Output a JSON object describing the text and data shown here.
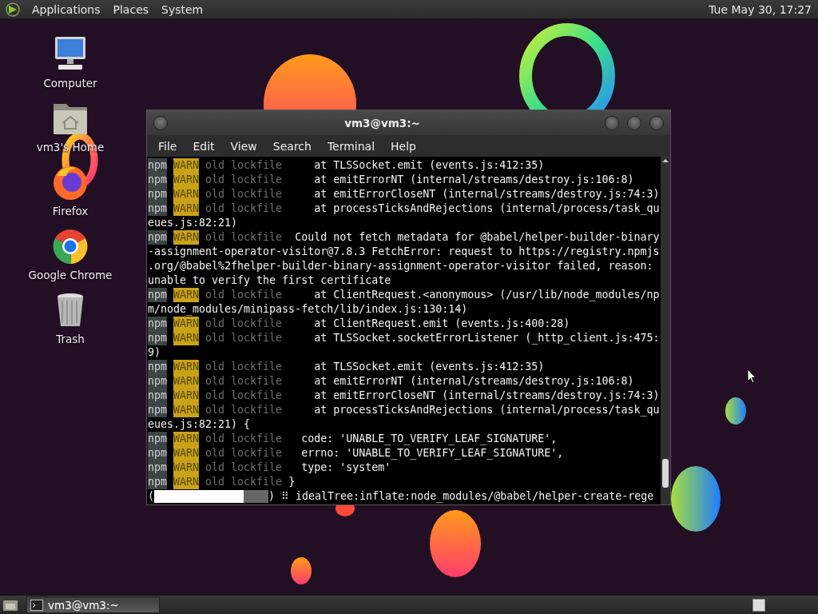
{
  "top_panel": {
    "menus": [
      "Applications",
      "Places",
      "System"
    ],
    "clock": "Tue May 30, 17:27"
  },
  "desktop_icons": [
    {
      "label": "Computer",
      "kind": "computer"
    },
    {
      "label": "vm3's Home",
      "kind": "home"
    },
    {
      "label": "Firefox",
      "kind": "firefox"
    },
    {
      "label": "Google Chrome",
      "kind": "chrome"
    },
    {
      "label": "Trash",
      "kind": "trash"
    }
  ],
  "terminal": {
    "title": "vm3@vm3:~",
    "menu": [
      "File",
      "Edit",
      "View",
      "Search",
      "Terminal",
      "Help"
    ],
    "lines": [
      {
        "kind": "stack",
        "npm": "npm",
        "level_tag": "WARN",
        "tag": "old lockfile",
        "text": "at TLSSocket.emit (events.js:412:35)"
      },
      {
        "kind": "stack",
        "npm": "npm",
        "level_tag": "WARN",
        "tag": "old lockfile",
        "text": "at emitErrorNT (internal/streams/destroy.js:106:8)"
      },
      {
        "kind": "stack",
        "npm": "npm",
        "level_tag": "WARN",
        "tag": "old lockfile",
        "text": "at emitErrorCloseNT (internal/streams/destroy.js:74:3)"
      },
      {
        "kind": "stack",
        "npm": "npm",
        "level_tag": "WARN",
        "tag": "old lockfile",
        "text": "at processTicksAndRejections (internal/process/task_qu"
      },
      {
        "kind": "plain",
        "text": "eues.js:82:21)"
      },
      {
        "kind": "info",
        "npm": "npm",
        "level_tag": "WARN",
        "tag": "old lockfile",
        "text": "Could not fetch metadata for @babel/helper-builder-binary"
      },
      {
        "kind": "plain",
        "text": "-assignment-operator-visitor@7.8.3 FetchError: request to https://registry.npmjs"
      },
      {
        "kind": "plain",
        "text": ".org/@babel%2fhelper-builder-binary-assignment-operator-visitor failed, reason:"
      },
      {
        "kind": "plain",
        "text": "unable to verify the first certificate"
      },
      {
        "kind": "stack",
        "npm": "npm",
        "level_tag": "WARN",
        "tag": "old lockfile",
        "text": "at ClientRequest.<anonymous> (/usr/lib/node_modules/np"
      },
      {
        "kind": "plain",
        "text": "m/node_modules/minipass-fetch/lib/index.js:130:14)"
      },
      {
        "kind": "stack",
        "npm": "npm",
        "level_tag": "WARN",
        "tag": "old lockfile",
        "text": "at ClientRequest.emit (events.js:400:28)"
      },
      {
        "kind": "stack",
        "npm": "npm",
        "level_tag": "WARN",
        "tag": "old lockfile",
        "text": "at TLSSocket.socketErrorListener (_http_client.js:475:"
      },
      {
        "kind": "plain",
        "text": "9)"
      },
      {
        "kind": "stack",
        "npm": "npm",
        "level_tag": "WARN",
        "tag": "old lockfile",
        "text": "at TLSSocket.emit (events.js:412:35)"
      },
      {
        "kind": "stack",
        "npm": "npm",
        "level_tag": "WARN",
        "tag": "old lockfile",
        "text": "at emitErrorNT (internal/streams/destroy.js:106:8)"
      },
      {
        "kind": "stack",
        "npm": "npm",
        "level_tag": "WARN",
        "tag": "old lockfile",
        "text": "at emitErrorCloseNT (internal/streams/destroy.js:74:3)"
      },
      {
        "kind": "stack",
        "npm": "npm",
        "level_tag": "WARN",
        "tag": "old lockfile",
        "text": "at processTicksAndRejections (internal/process/task_qu"
      },
      {
        "kind": "plain",
        "text": "eues.js:82:21) {"
      },
      {
        "kind": "detail",
        "npm": "npm",
        "level_tag": "WARN",
        "tag": "old lockfile",
        "text": "code: 'UNABLE_TO_VERIFY_LEAF_SIGNATURE',"
      },
      {
        "kind": "detail",
        "npm": "npm",
        "level_tag": "WARN",
        "tag": "old lockfile",
        "text": "errno: 'UNABLE_TO_VERIFY_LEAF_SIGNATURE',"
      },
      {
        "kind": "detail",
        "npm": "npm",
        "level_tag": "WARN",
        "tag": "old lockfile",
        "text": "type: 'system'"
      },
      {
        "kind": "close",
        "npm": "npm",
        "level_tag": "WARN",
        "tag": "old lockfile",
        "text": "}"
      },
      {
        "kind": "progress",
        "open": "(",
        "level": 0.78,
        "close": ")",
        "spinner": "⠿",
        "text": "idealTree:inflate:node_modules/@babel/helper-create-rege"
      }
    ]
  },
  "taskbar": {
    "tasks": [
      {
        "label": "vm3@vm3:~",
        "selected": true
      }
    ]
  }
}
